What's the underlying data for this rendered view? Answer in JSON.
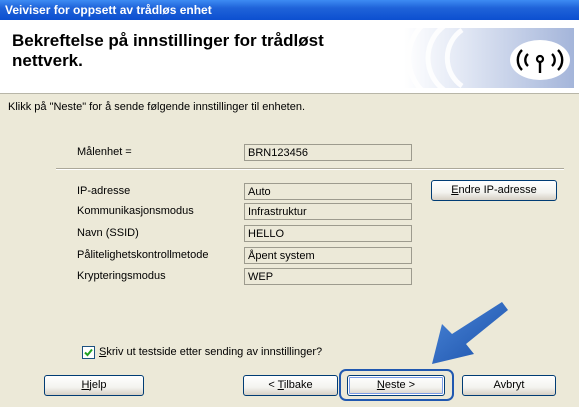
{
  "window": {
    "title": "Veiviser for oppsett av trådløs enhet"
  },
  "header": {
    "title": "Bekreftelse på innstillinger for trådløst nettverk."
  },
  "instruction": "Klikk på \"Neste\" for å sende følgende innstillinger til enheten.",
  "target_device": {
    "label": "Målenhet =",
    "value": "BRN123456"
  },
  "settings": [
    {
      "label": "IP-adresse",
      "value": "Auto"
    },
    {
      "label": "Kommunikasjonsmodus",
      "value": "Infrastruktur"
    },
    {
      "label": "Navn (SSID)",
      "value": "HELLO"
    },
    {
      "label": "Pålitelighetskontrollmetode",
      "value": "Åpent system"
    },
    {
      "label": "Krypteringsmodus",
      "value": "WEP"
    }
  ],
  "buttons": {
    "change_ip": {
      "mnemonic": "E",
      "rest": "ndre IP-adresse"
    },
    "help": {
      "mnemonic": "H",
      "rest": "jelp"
    },
    "back": {
      "prefix": "< ",
      "mnemonic": "T",
      "rest": "ilbake"
    },
    "next": {
      "mnemonic": "N",
      "rest": "este >"
    },
    "cancel": "Avbryt"
  },
  "print_test_page": {
    "checked": true,
    "mnemonic": "S",
    "rest": "kriv ut testside etter sending av innstillinger?"
  },
  "colors": {
    "titlebar": "#0c4fd0",
    "accent_arrow": "#1d5bb6",
    "dialog_bg": "#ece9d8"
  },
  "icons": {
    "logo": "wireless-signal-icon",
    "pointer": "arrow-pointer-icon"
  }
}
